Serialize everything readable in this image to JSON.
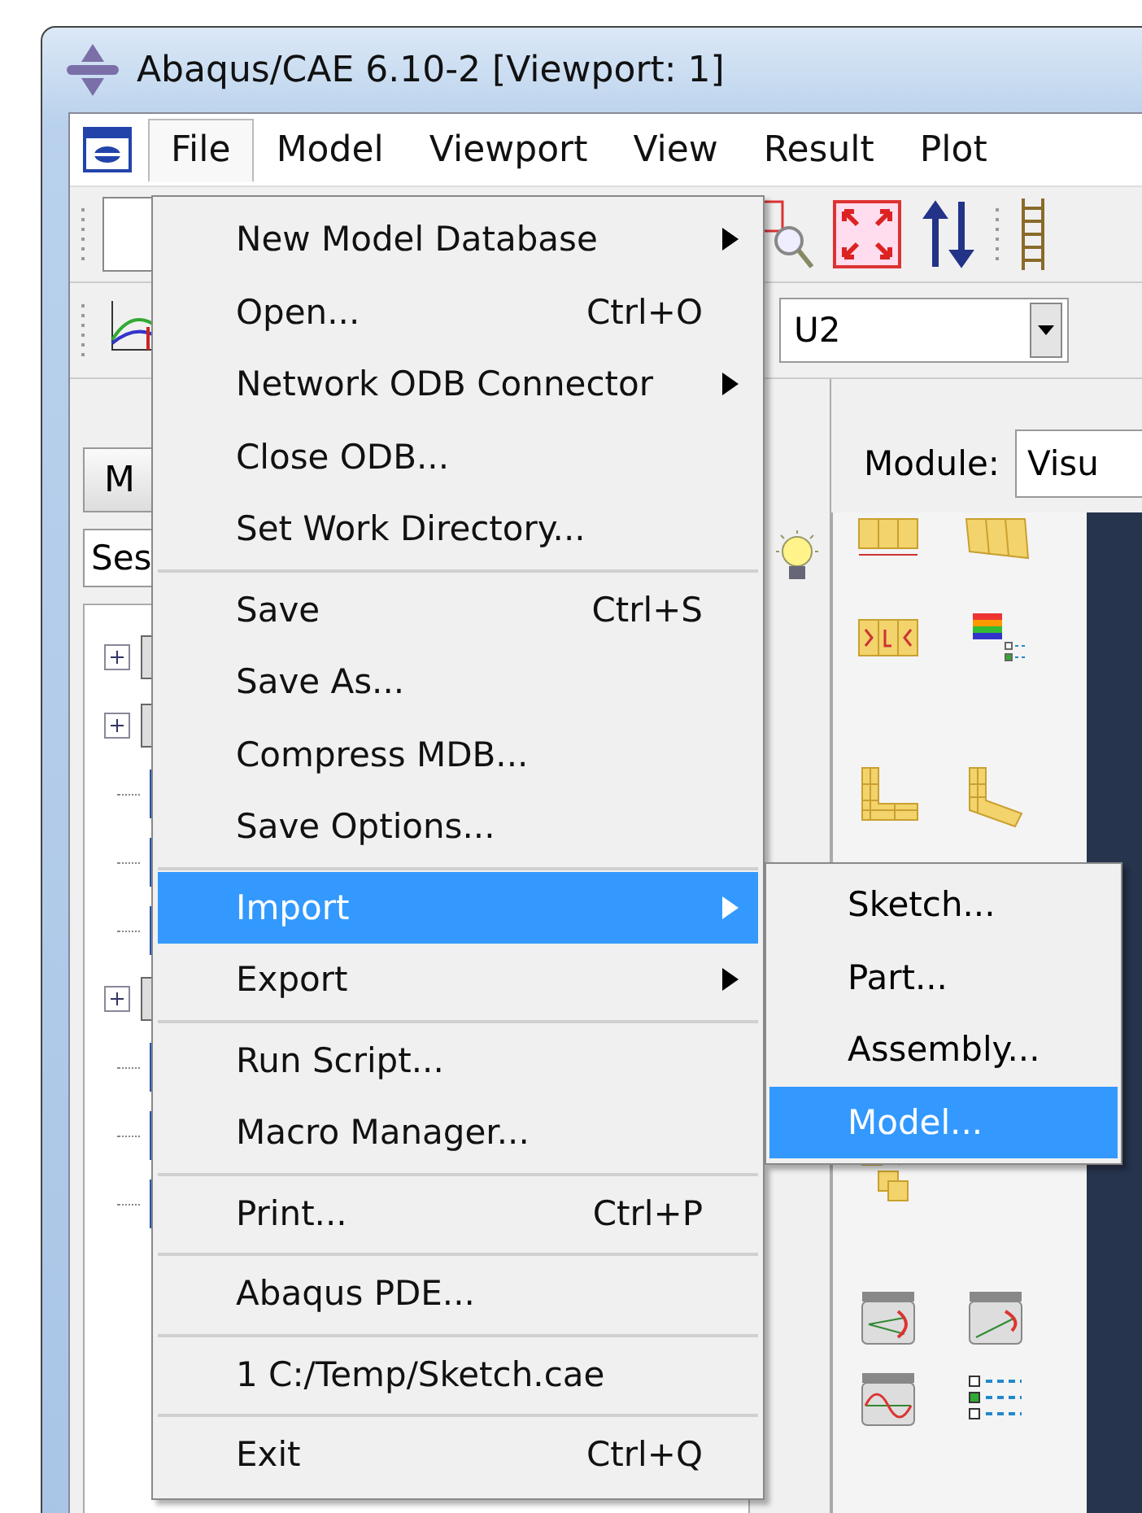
{
  "window": {
    "title": "Abaqus/CAE 6.10-2 [Viewport: 1]"
  },
  "menubar": [
    {
      "label": "File",
      "selected": true
    },
    {
      "label": "Model",
      "selected": false
    },
    {
      "label": "Viewport",
      "selected": false
    },
    {
      "label": "View",
      "selected": false
    },
    {
      "label": "Result",
      "selected": false
    },
    {
      "label": "Plot",
      "selected": false
    }
  ],
  "toolbar": {
    "field_dropdown": {
      "value": "U2"
    }
  },
  "left_panel": {
    "tab": {
      "label": "M"
    },
    "session_field": {
      "value": "Ses"
    },
    "tree_rows": [
      {
        "kind": "toggle"
      },
      {
        "kind": "toggle"
      },
      {
        "kind": "leaf"
      },
      {
        "kind": "leaf"
      },
      {
        "kind": "leaf"
      },
      {
        "kind": "toggle"
      },
      {
        "kind": "leaf"
      },
      {
        "kind": "leaf"
      },
      {
        "kind": "leaf"
      }
    ]
  },
  "module": {
    "label": "Module:",
    "value": "Visu"
  },
  "file_menu": {
    "groups": [
      {
        "items": [
          {
            "label": "New Model Database",
            "submenu": true,
            "selected": false
          },
          {
            "label": "Open...",
            "shortcut": "Ctrl+O",
            "submenu": false,
            "selected": false
          },
          {
            "label": "Network ODB Connector",
            "submenu": true,
            "selected": false
          },
          {
            "label": "Close ODB...",
            "submenu": false,
            "selected": false
          },
          {
            "label": "Set Work Directory...",
            "submenu": false,
            "selected": false
          }
        ]
      },
      {
        "items": [
          {
            "label": "Save",
            "shortcut": "Ctrl+S",
            "submenu": false,
            "selected": false
          },
          {
            "label": "Save As...",
            "submenu": false,
            "selected": false
          },
          {
            "label": "Compress MDB...",
            "submenu": false,
            "selected": false
          },
          {
            "label": "Save Options...",
            "submenu": false,
            "selected": false
          }
        ]
      },
      {
        "items": [
          {
            "label": "Import",
            "submenu": true,
            "selected": true
          },
          {
            "label": "Export",
            "submenu": true,
            "selected": false
          }
        ]
      },
      {
        "items": [
          {
            "label": "Run Script...",
            "submenu": false,
            "selected": false
          },
          {
            "label": "Macro Manager...",
            "submenu": false,
            "selected": false
          }
        ]
      },
      {
        "items": [
          {
            "label": "Print...",
            "shortcut": "Ctrl+P",
            "submenu": false,
            "selected": false
          }
        ]
      },
      {
        "items": [
          {
            "label": "Abaqus PDE...",
            "submenu": false,
            "selected": false
          }
        ]
      },
      {
        "items": [
          {
            "label": "1 C:/Temp/Sketch.cae",
            "submenu": false,
            "selected": false
          }
        ]
      },
      {
        "items": [
          {
            "label": "Exit",
            "shortcut": "Ctrl+Q",
            "submenu": false,
            "selected": false
          }
        ]
      }
    ]
  },
  "import_submenu": {
    "items": [
      {
        "label": "Sketch...",
        "selected": false
      },
      {
        "label": "Part...",
        "selected": false
      },
      {
        "label": "Assembly...",
        "selected": false
      },
      {
        "label": "Model...",
        "selected": true
      }
    ]
  }
}
